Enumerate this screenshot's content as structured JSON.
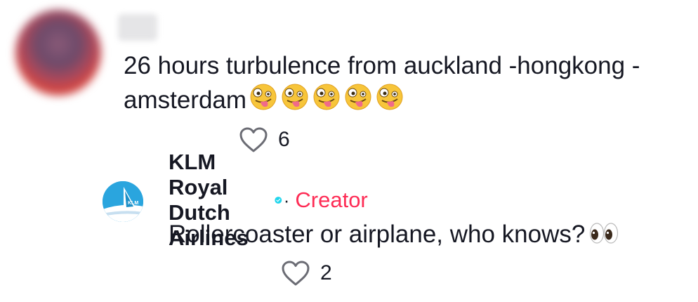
{
  "top_comment": {
    "username": "",
    "text": "26 hours turbulence from auckland -hongkong - amsterdam",
    "emojis": [
      "zany-face",
      "zany-face",
      "zany-face",
      "zany-face",
      "zany-face"
    ],
    "likes": "6"
  },
  "reply": {
    "author": "KLM Royal Dutch Airlines",
    "verified": true,
    "separator": "·",
    "creator_label": "Creator",
    "avatar_logo_text": "KLM",
    "text": "Rollercoaster or airplane, who knows?",
    "emoji": "eyes",
    "likes": "2"
  },
  "colors": {
    "text": "#161823",
    "creator": "#fe2c55",
    "verified": "#20d5ec",
    "klm_blue": "#2aa5de"
  }
}
